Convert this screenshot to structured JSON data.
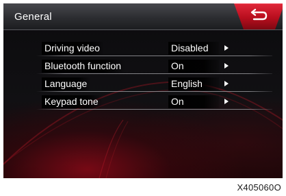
{
  "header": {
    "title": "General",
    "back_icon": "return-arrow-icon",
    "accent_color": "#c8101f"
  },
  "settings": [
    {
      "label": "Driving video",
      "value": "Disabled"
    },
    {
      "label": "Bluetooth function",
      "value": "On"
    },
    {
      "label": "Language",
      "value": "English"
    },
    {
      "label": "Keypad tone",
      "value": "On"
    }
  ],
  "figure_id": "X405060O"
}
